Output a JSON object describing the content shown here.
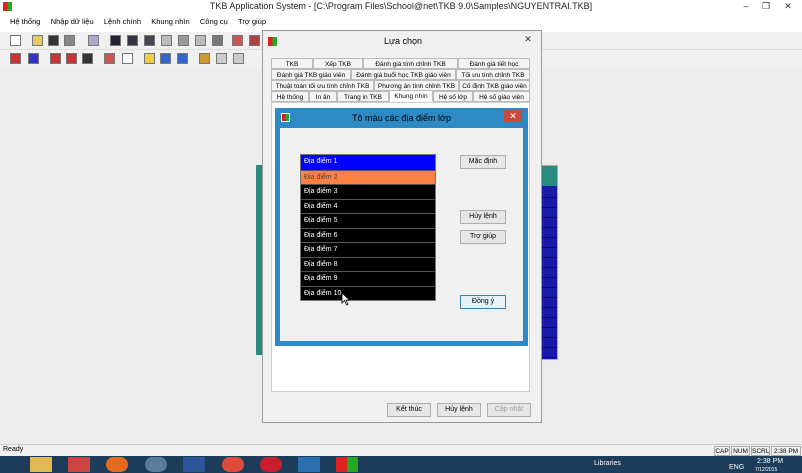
{
  "app": {
    "title": "TKB Application System - [C:\\Program Files\\School@net\\TKB 9.0\\Samples\\NGUYENTRAI.TKB]"
  },
  "menu": [
    "Hệ thống",
    "Nhập dữ liệu",
    "Lệnh chính",
    "Khung nhìn",
    "Công cụ",
    "Trợ giúp"
  ],
  "options_dialog": {
    "title": "Lựa chọn",
    "tabs_row1": [
      "TKB",
      "Xếp TKB",
      "Đánh giá tính chỉnh TKB",
      "Đánh giá tiết học"
    ],
    "tabs_row2": [
      "Đánh giá TKB giáo viên",
      "Đánh giá buổi học TKB giáo viên",
      "Tối ưu tính chỉnh TKB"
    ],
    "tabs_row3": [
      "Thuật toán tối ưu tính chỉnh TKB",
      "Phương án tính chỉnh TKB",
      "Cố định TKB giáo viên"
    ],
    "tabs_row4": [
      "Hệ thống",
      "In ấn",
      "Trang in TKB",
      "Khung nhìn",
      "Hệ số lớp",
      "Hệ số giáo viên"
    ],
    "active_tab": "Khung nhìn",
    "buttons": {
      "finish": "Kết thúc",
      "cancel": "Hủy lệnh",
      "update": "Cập nhật"
    }
  },
  "color_dialog": {
    "title": "Tô màu các địa điểm lớp",
    "items": [
      {
        "label": "Địa điểm 1",
        "color": "#0000ff"
      },
      {
        "label": "Địa điểm 2",
        "color": "#ff8040"
      },
      {
        "label": "Địa điểm 3",
        "color": "#000000"
      },
      {
        "label": "Địa điểm 4",
        "color": "#000000"
      },
      {
        "label": "Địa điểm 5",
        "color": "#000000"
      },
      {
        "label": "Địa điểm 6",
        "color": "#000000"
      },
      {
        "label": "Địa điểm 7",
        "color": "#000000"
      },
      {
        "label": "Địa điểm 8",
        "color": "#000000"
      },
      {
        "label": "Địa điểm 9",
        "color": "#000000"
      },
      {
        "label": "Địa điểm 10",
        "color": "#000000"
      }
    ],
    "buttons": {
      "default": "Mặc định",
      "cancel": "Hủy lệnh",
      "help": "Trợ giúp",
      "ok": "Đồng ý"
    }
  },
  "status": {
    "text": "Ready",
    "indicators": [
      "CAP",
      "NUM",
      "SCRL",
      "2:38 PM"
    ]
  },
  "taskbar": {
    "libraries": "Libraries",
    "lang": "ENG",
    "time": "2:38 PM",
    "date": "7/12/2015"
  }
}
